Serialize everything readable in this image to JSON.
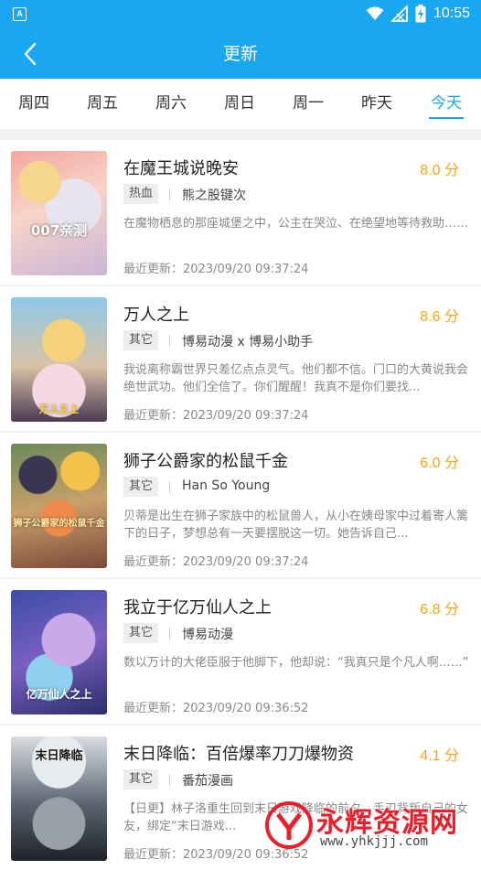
{
  "status_bar": {
    "time": "10:55",
    "app_badge": "A"
  },
  "app_bar": {
    "title": "更新"
  },
  "tabs": [
    {
      "label": "周四",
      "active": false
    },
    {
      "label": "周五",
      "active": false
    },
    {
      "label": "周六",
      "active": false
    },
    {
      "label": "周日",
      "active": false
    },
    {
      "label": "周一",
      "active": false
    },
    {
      "label": "昨天",
      "active": false
    },
    {
      "label": "今天",
      "active": true
    }
  ],
  "colors": {
    "primary": "#1aa7f2",
    "score": "#f2a516",
    "watermark": "#e8202a"
  },
  "items": [
    {
      "title": "在魔王城说晚安",
      "score": "8.0 分",
      "tag": "热血",
      "author": "熊之股键次",
      "desc": "在魔物栖息的那座城堡之中，公主在哭泣、在绝望地等待救助……",
      "updated": "最近更新：2023/09/20 09:37:24",
      "cover_text": "007亲测"
    },
    {
      "title": "万人之上",
      "score": "8.6 分",
      "tag": "其它",
      "author": "博易动漫 x 博易小助手",
      "desc": "我说离称霸世界只差亿点点灵气。他们都不信。门口的大黄说我会绝世武功。他们全信了。你们醒醒！我真不是你们要找...",
      "updated": "最近更新：2023/09/20 09:37:24",
      "cover_text": "万人之上"
    },
    {
      "title": "狮子公爵家的松鼠千金",
      "score": "6.0 分",
      "tag": "其它",
      "author": "Han So Young",
      "desc": "贝蒂是出生在狮子家族中的松鼠兽人，从小在姨母家中过着寄人篱下的日子，梦想总有一天要摆脱这一切。她告诉自己...",
      "updated": "最近更新：2023/09/20 09:37:24",
      "cover_text": "狮子公爵家的松鼠千金"
    },
    {
      "title": "我立于亿万仙人之上",
      "score": "6.8 分",
      "tag": "其它",
      "author": "博易动漫",
      "desc": "数以万计的大佬臣服于他脚下，他却说：“我真只是个凡人啊……”",
      "updated": "最近更新：2023/09/20 09:36:52",
      "cover_text": "亿万仙人之上"
    },
    {
      "title": "末日降临：百倍爆率刀刀爆物资",
      "score": "4.1 分",
      "tag": "其它",
      "author": "番茄漫画",
      "desc": "【日更】林子洛重生回到末日游戏降临的前夕，手刃背叛自己的女友，绑定“末日游戏...",
      "updated": "最近更新：2023/09/20 09:36:52",
      "cover_text": "末日降临"
    }
  ],
  "watermark": {
    "name": "永辉资源网",
    "url": "www.yhkjjj.com"
  }
}
